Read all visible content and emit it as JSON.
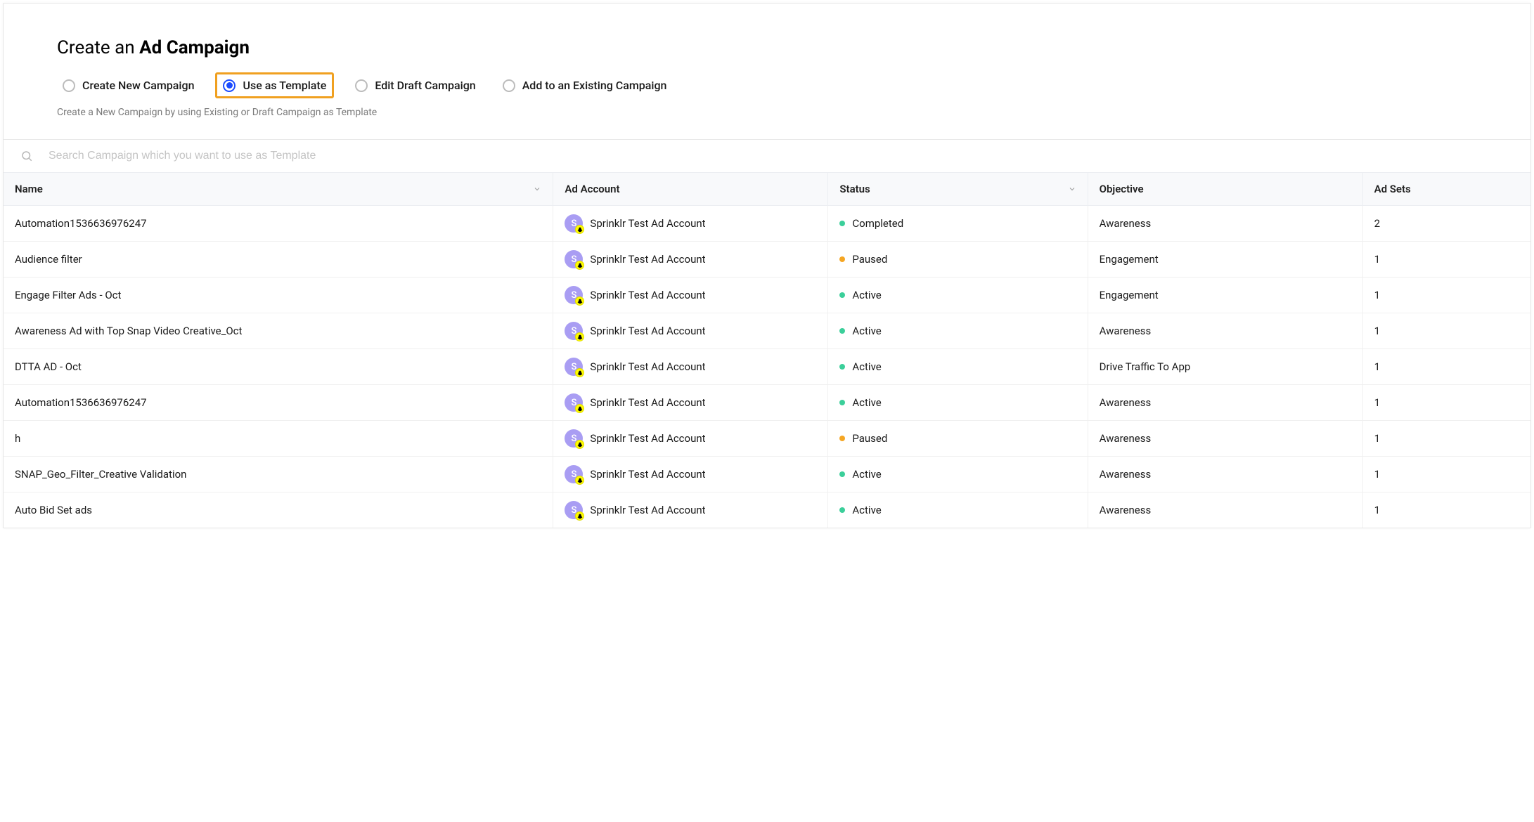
{
  "page_title_prefix": "Create an ",
  "page_title_bold": "Ad Campaign",
  "radio_options": [
    {
      "label": "Create New Campaign",
      "selected": false,
      "highlighted": false
    },
    {
      "label": "Use as Template",
      "selected": true,
      "highlighted": true
    },
    {
      "label": "Edit Draft Campaign",
      "selected": false,
      "highlighted": false
    },
    {
      "label": "Add to an Existing Campaign",
      "selected": false,
      "highlighted": false
    }
  ],
  "radio_description": "Create a New Campaign by using Existing or Draft Campaign as Template",
  "search": {
    "placeholder": "Search Campaign which you want to use as Template",
    "value": ""
  },
  "columns": [
    {
      "label": "Name",
      "sortable": true
    },
    {
      "label": "Ad Account",
      "sortable": false
    },
    {
      "label": "Status",
      "sortable": true
    },
    {
      "label": "Objective",
      "sortable": false
    },
    {
      "label": "Ad Sets",
      "sortable": false
    }
  ],
  "account_avatar_letter": "S",
  "status_colors": {
    "Completed": "#3bcf9a",
    "Paused": "#f5a623",
    "Active": "#3bcf9a"
  },
  "rows": [
    {
      "name": "Automation1536636976247",
      "account": "Sprinklr Test Ad Account",
      "status": "Completed",
      "objective": "Awareness",
      "adsets": "2"
    },
    {
      "name": "Audience filter",
      "account": "Sprinklr Test Ad Account",
      "status": "Paused",
      "objective": "Engagement",
      "adsets": "1"
    },
    {
      "name": "Engage Filter Ads - Oct",
      "account": "Sprinklr Test Ad Account",
      "status": "Active",
      "objective": "Engagement",
      "adsets": "1"
    },
    {
      "name": "Awareness Ad with Top Snap Video Creative_Oct",
      "account": "Sprinklr Test Ad Account",
      "status": "Active",
      "objective": "Awareness",
      "adsets": "1"
    },
    {
      "name": "DTTA AD - Oct",
      "account": "Sprinklr Test Ad Account",
      "status": "Active",
      "objective": "Drive Traffic To App",
      "adsets": "1"
    },
    {
      "name": "Automation1536636976247",
      "account": "Sprinklr Test Ad Account",
      "status": "Active",
      "objective": "Awareness",
      "adsets": "1"
    },
    {
      "name": "h",
      "account": "Sprinklr Test Ad Account",
      "status": "Paused",
      "objective": "Awareness",
      "adsets": "1"
    },
    {
      "name": "SNAP_Geo_Filter_Creative Validation",
      "account": "Sprinklr Test Ad Account",
      "status": "Active",
      "objective": "Awareness",
      "adsets": "1"
    },
    {
      "name": "Auto Bid Set ads",
      "account": "Sprinklr Test Ad Account",
      "status": "Active",
      "objective": "Awareness",
      "adsets": "1"
    }
  ]
}
